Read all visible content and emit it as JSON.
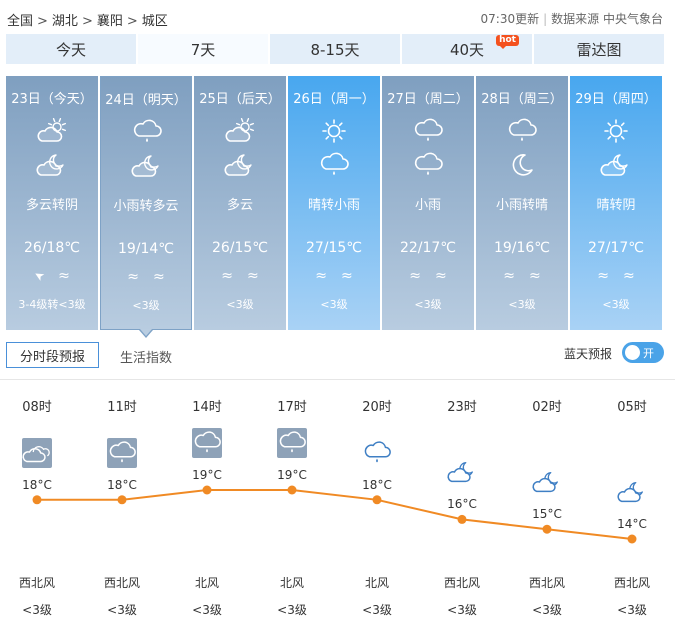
{
  "breadcrumb": [
    "全国",
    "湖北",
    "襄阳",
    "城区"
  ],
  "meta": {
    "update": "07:30更新",
    "source": "数据来源 中央气象台"
  },
  "tabs": [
    {
      "label": "今天",
      "active": false
    },
    {
      "label": "7天",
      "active": true
    },
    {
      "label": "8-15天",
      "active": false
    },
    {
      "label": "40天",
      "active": false,
      "badge": "hot"
    },
    {
      "label": "雷达图",
      "active": false
    }
  ],
  "days": [
    {
      "date": "23日（今天）",
      "icon_day": "partly-cloudy-icon",
      "icon_night": "partly-cloudy-night-icon",
      "desc": "多云转阴",
      "temp": "26/18℃",
      "wind_icons": [
        "➤",
        "≈"
      ],
      "wind": "3-4级转<3级",
      "style": "gray"
    },
    {
      "date": "24日（明天）",
      "icon_day": "rain-icon",
      "icon_night": "partly-cloudy-night-icon",
      "desc": "小雨转多云",
      "temp": "19/14℃",
      "wind_icons": [
        "≈",
        "≈"
      ],
      "wind": "<3级",
      "style": "gray"
    },
    {
      "date": "25日（后天）",
      "icon_day": "partly-cloudy-icon",
      "icon_night": "partly-cloudy-night-icon",
      "desc": "多云",
      "temp": "26/15℃",
      "wind_icons": [
        "≈",
        "≈"
      ],
      "wind": "<3级",
      "style": "gray"
    },
    {
      "date": "26日（周一）",
      "icon_day": "sun-icon",
      "icon_night": "rain-icon",
      "desc": "晴转小雨",
      "temp": "27/15℃",
      "wind_icons": [
        "≈",
        "≈"
      ],
      "wind": "<3级",
      "style": "sunny"
    },
    {
      "date": "27日（周二）",
      "icon_day": "rain-icon",
      "icon_night": "rain-icon",
      "desc": "小雨",
      "temp": "22/17℃",
      "wind_icons": [
        "≈",
        "≈"
      ],
      "wind": "<3级",
      "style": "gray"
    },
    {
      "date": "28日（周三）",
      "icon_day": "rain-icon",
      "icon_night": "moon-icon",
      "desc": "小雨转晴",
      "temp": "19/16℃",
      "wind_icons": [
        "≈",
        "≈"
      ],
      "wind": "<3级",
      "style": "gray"
    },
    {
      "date": "29日（周四）",
      "icon_day": "sun-icon",
      "icon_night": "partly-cloudy-night-icon",
      "desc": "晴转阴",
      "temp": "27/17℃",
      "wind_icons": [
        "≈",
        "≈"
      ],
      "wind": "<3级",
      "style": "sunny"
    }
  ],
  "selected_day": 1,
  "subtabs": {
    "hourly": "分时段预报",
    "life": "生活指数"
  },
  "toggle": {
    "label": "蓝天预报",
    "state": "开"
  },
  "hourly": [
    {
      "time": "08时",
      "temp": 18,
      "temp_label": "18°C",
      "icon": "cloudy-icon",
      "dir": "西北风",
      "level": "<3级"
    },
    {
      "time": "11时",
      "temp": 18,
      "temp_label": "18°C",
      "icon": "rain-icon",
      "dir": "西北风",
      "level": "<3级"
    },
    {
      "time": "14时",
      "temp": 19,
      "temp_label": "19°C",
      "icon": "rain-icon",
      "dir": "北风",
      "level": "<3级"
    },
    {
      "time": "17时",
      "temp": 19,
      "temp_label": "19°C",
      "icon": "rain-icon",
      "dir": "北风",
      "level": "<3级"
    },
    {
      "time": "20时",
      "temp": 18,
      "temp_label": "18°C",
      "icon": "rain-icon",
      "dir": "北风",
      "level": "<3级"
    },
    {
      "time": "23时",
      "temp": 16,
      "temp_label": "16°C",
      "icon": "partly-cloudy-night-icon",
      "dir": "西北风",
      "level": "<3级"
    },
    {
      "time": "02时",
      "temp": 15,
      "temp_label": "15°C",
      "icon": "partly-cloudy-night-icon",
      "dir": "西北风",
      "level": "<3级"
    },
    {
      "time": "05时",
      "temp": 14,
      "temp_label": "14°C",
      "icon": "partly-cloudy-night-icon",
      "dir": "西北风",
      "level": "<3级"
    }
  ],
  "colors": {
    "accent": "#f08a24",
    "tab_bg": "#e3eef9",
    "toggle": "#4aa3e8"
  }
}
